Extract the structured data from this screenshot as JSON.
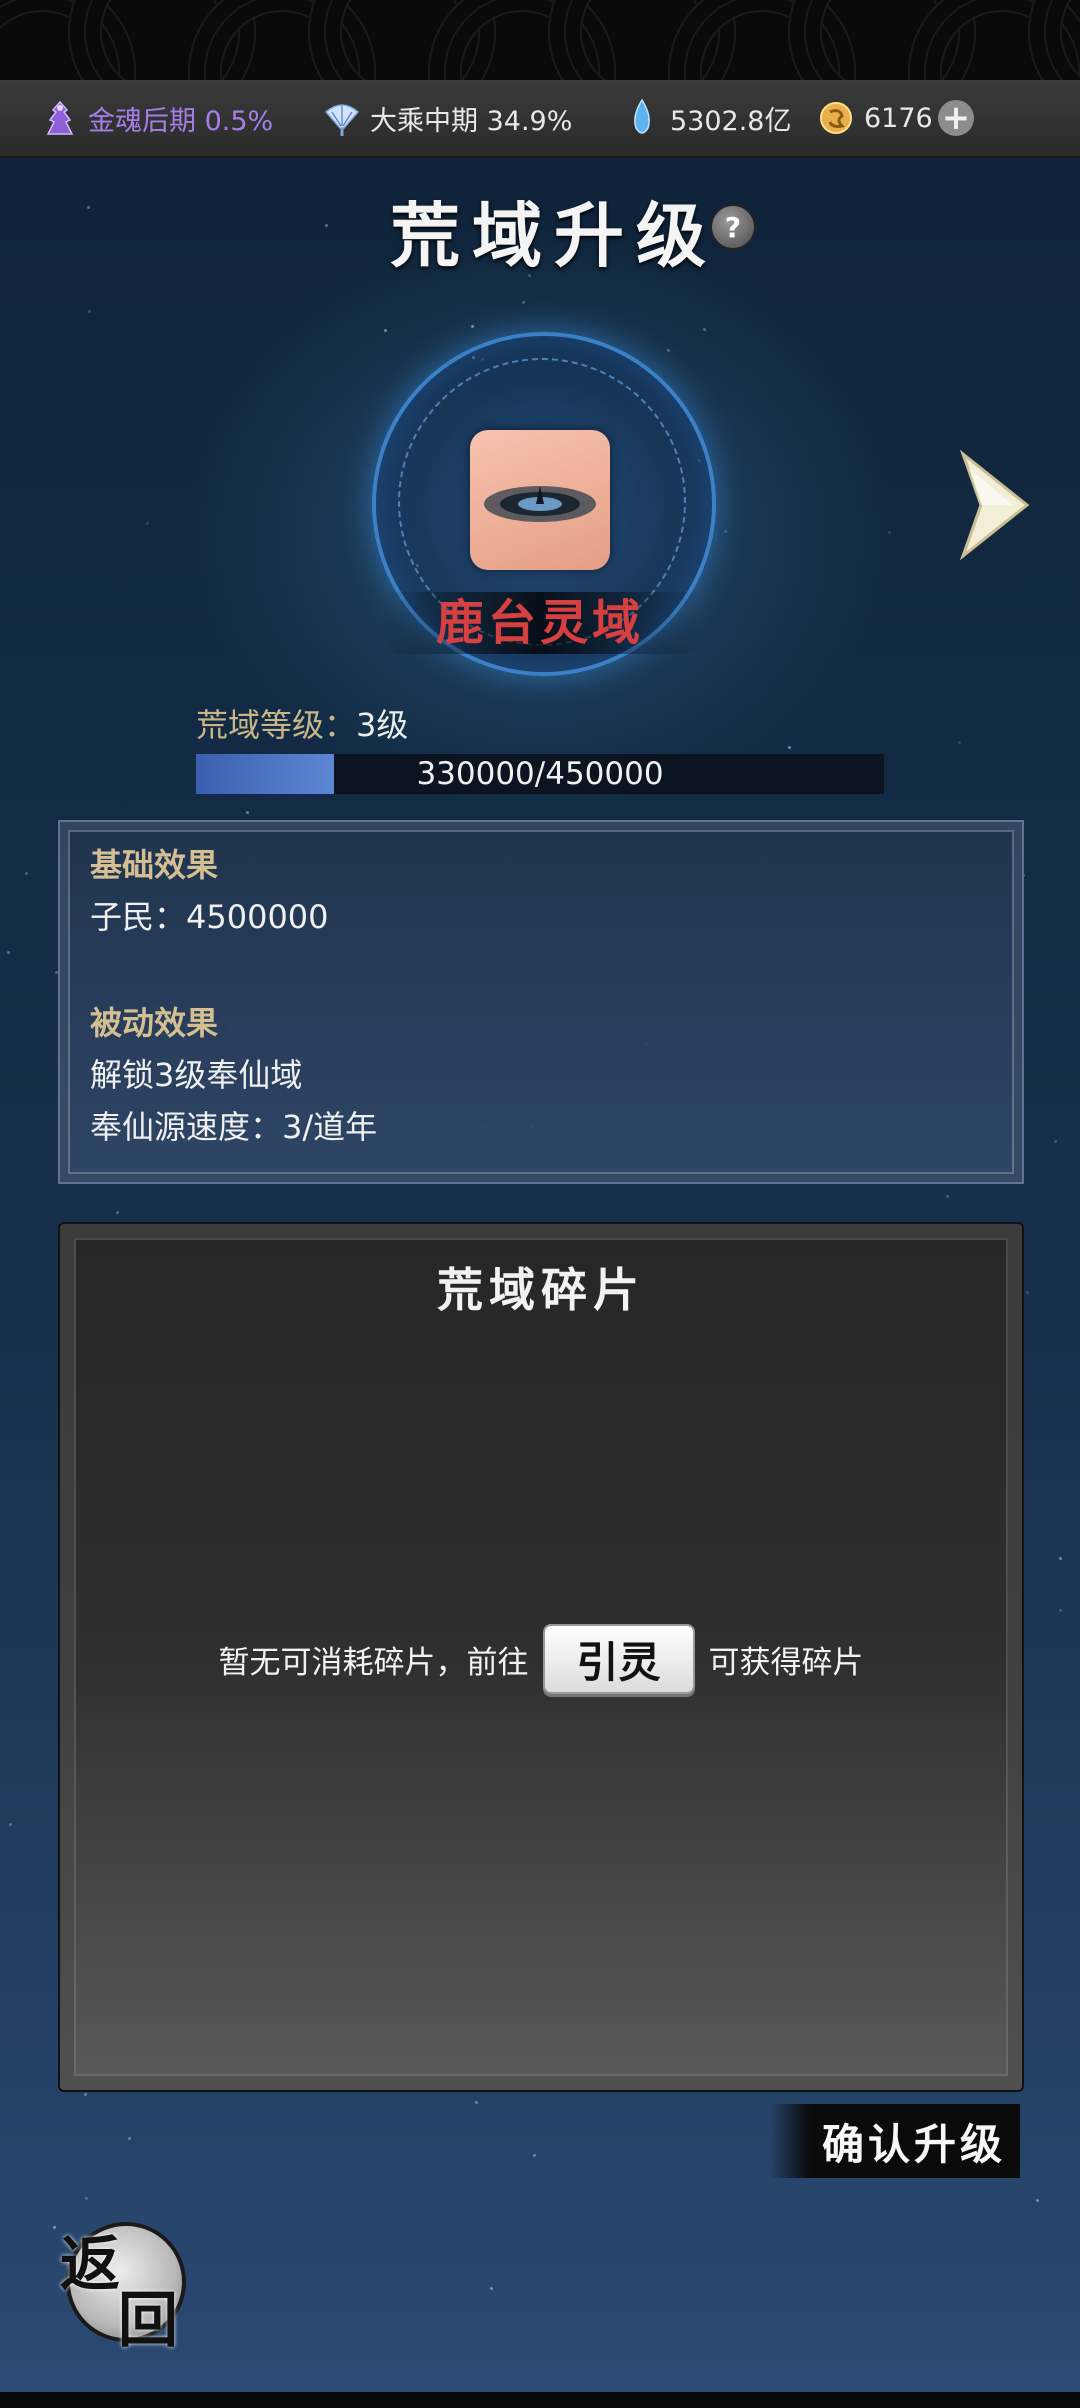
{
  "resources": [
    {
      "name": "cultivation-realm",
      "icon": "purple-figure-icon",
      "text": "金魂后期 0.5%",
      "color": "#a57ee8"
    },
    {
      "name": "realm-progress",
      "icon": "fan-icon",
      "text": "大乘中期 34.9%",
      "color": "#f0f0f0"
    },
    {
      "name": "spirit-stone",
      "icon": "blue-crystal-icon",
      "text": "5302.8亿",
      "color": "#e6e6e6"
    },
    {
      "name": "gold-coin",
      "icon": "gold-coin-icon",
      "text": "6176",
      "color": "#e6e6e6"
    }
  ],
  "plus_label": "+",
  "title": "荒域升级",
  "help_label": "?",
  "domain_name": "鹿台灵域",
  "level": {
    "label": "荒域等级：",
    "value": "3级"
  },
  "progress": {
    "text": "330000/450000",
    "fraction": 0.2
  },
  "base_effect": {
    "heading": "基础效果",
    "line1": "子民：4500000"
  },
  "passive_effect": {
    "heading": "被动效果",
    "line1": "解锁3级奉仙域",
    "line2": "奉仙源速度：3/道年"
  },
  "shards": {
    "title": "荒域碎片",
    "msg_before": "暂无可消耗碎片，前往",
    "button": "引灵",
    "msg_after": "可获得碎片"
  },
  "confirm_label": "确认升级",
  "back_label": {
    "char1": "返",
    "char2": "回"
  },
  "colors": {
    "accent_red": "#d64040",
    "gold_text": "#c9b58a",
    "progress_blue": "#5d86d4"
  }
}
